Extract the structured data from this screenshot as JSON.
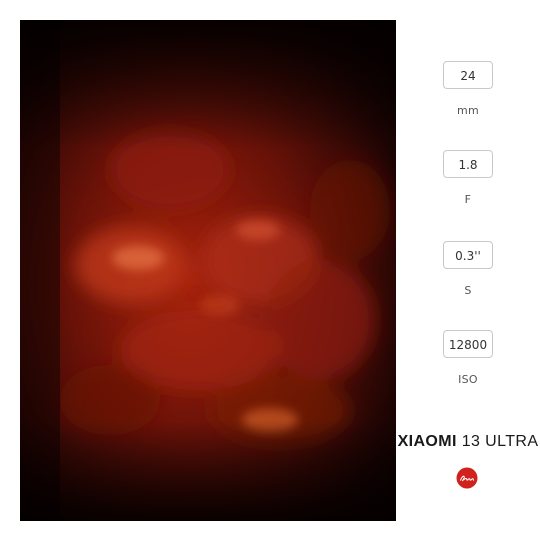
{
  "colors": {
    "background": "#ffffff",
    "box_border": "#c9c9c9",
    "text": "#333333",
    "logo_red": "#d0211c"
  },
  "photo": {
    "icon": "blurred-red-petals-photo"
  },
  "exif": {
    "focal_length": {
      "value": "24",
      "unit": "mm"
    },
    "aperture": {
      "value": "1.8",
      "unit": "F"
    },
    "shutter": {
      "value": "0.3''",
      "unit": "S"
    },
    "iso": {
      "value": "12800",
      "unit": "ISO"
    }
  },
  "brand": {
    "name_bold": "XIAOMI",
    "name_light": " 13 ULTRA",
    "logo_text": "Leica",
    "logo_icon": "leica-logo-icon"
  }
}
